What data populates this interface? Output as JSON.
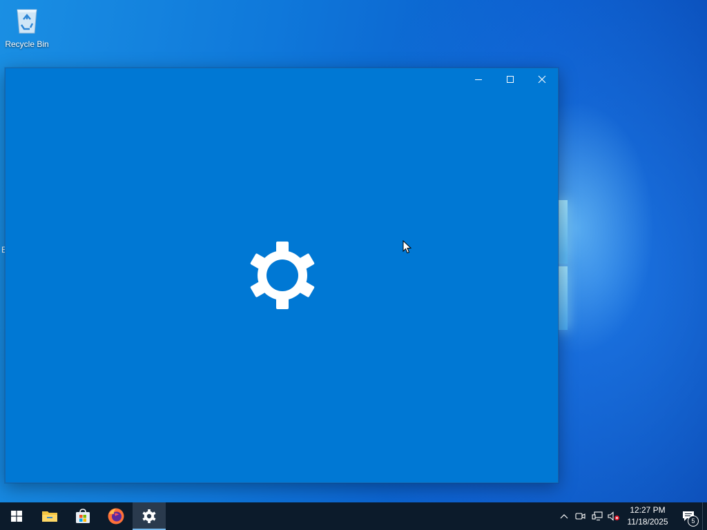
{
  "desktop": {
    "icons": [
      {
        "label": "Recycle Bin",
        "icon": "recycle-bin-icon"
      }
    ],
    "edge_text": "E"
  },
  "window": {
    "app": "Settings",
    "splash_icon": "gear-icon",
    "background": "#0078d4",
    "controls": {
      "minimize_icon": "minimize-icon",
      "maximize_icon": "maximize-icon",
      "close_icon": "close-icon"
    }
  },
  "taskbar": {
    "start_icon": "windows-logo-icon",
    "pinned": [
      {
        "app": "File Explorer",
        "icon": "folder-icon"
      },
      {
        "app": "Microsoft Store",
        "icon": "store-icon"
      },
      {
        "app": "Firefox",
        "icon": "firefox-icon"
      },
      {
        "app": "Settings",
        "icon": "gear-icon",
        "active": true
      }
    ],
    "tray": {
      "icons": [
        "chevron-up-icon",
        "meet-now-icon",
        "network-icon",
        "volume-muted-icon"
      ],
      "time": "12:27 PM",
      "date": "11/18/2025",
      "notification_count": "5"
    }
  }
}
